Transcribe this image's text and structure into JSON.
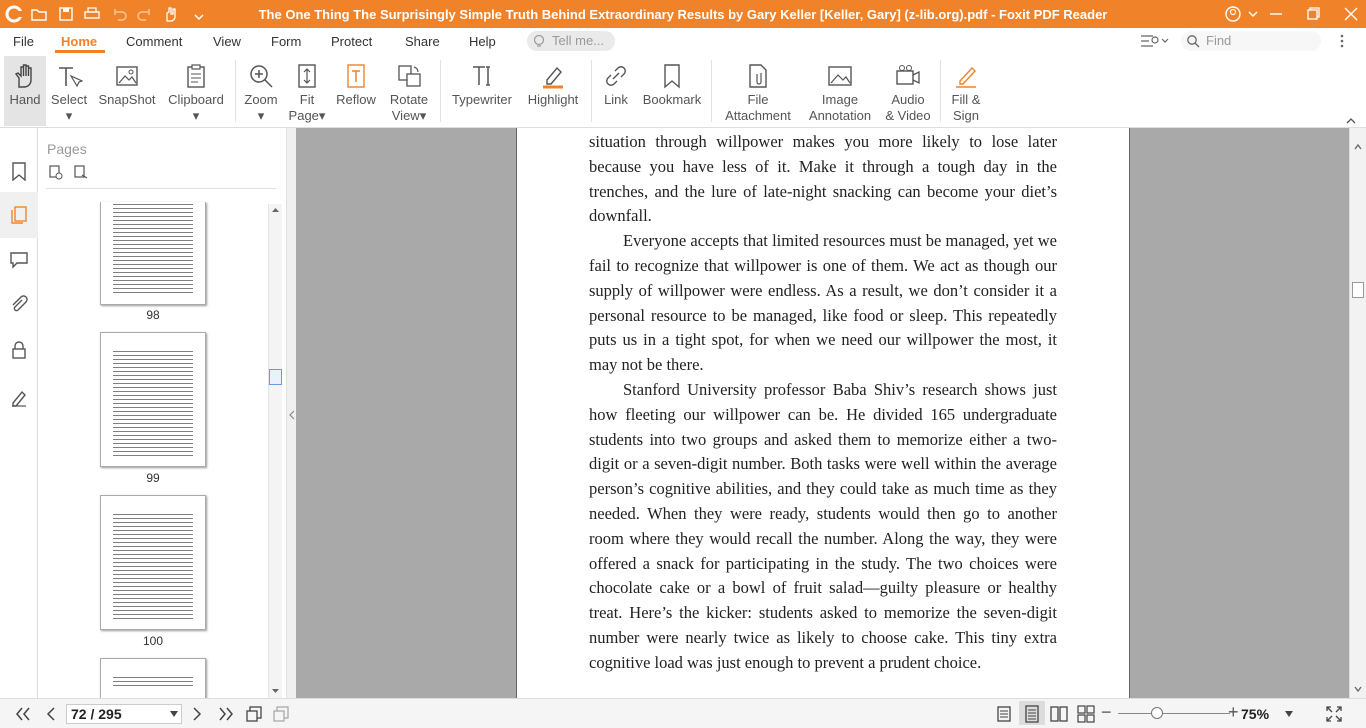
{
  "app": {
    "window_title": "The One Thing The Surprisingly Simple Truth Behind Extraordinary Results by Gary Keller [Keller, Gary] (z-lib.org).pdf - Foxit PDF Reader",
    "accent_color": "#f0832a"
  },
  "menu": {
    "items": [
      "File",
      "Home",
      "Comment",
      "View",
      "Form",
      "Protect",
      "Share",
      "Help"
    ],
    "active": "Home",
    "tell_me_placeholder": "Tell me...",
    "find_placeholder": "Find"
  },
  "ribbon": {
    "tools": [
      {
        "line1": "Hand",
        "line2": "",
        "icon": "hand-icon"
      },
      {
        "line1": "Select",
        "line2": "",
        "icon": "select-text-icon"
      },
      {
        "line1": "SnapShot",
        "line2": "",
        "icon": "snapshot-icon"
      },
      {
        "line1": "Clipboard",
        "line2": "",
        "icon": "clipboard-icon"
      },
      {
        "line1": "Zoom",
        "line2": "",
        "icon": "zoom-icon"
      },
      {
        "line1": "Fit",
        "line2": "Page",
        "icon": "fit-page-icon"
      },
      {
        "line1": "Reflow",
        "line2": "",
        "icon": "reflow-icon"
      },
      {
        "line1": "Rotate",
        "line2": "View",
        "icon": "rotate-view-icon"
      },
      {
        "line1": "Typewriter",
        "line2": "",
        "icon": "typewriter-icon"
      },
      {
        "line1": "Highlight",
        "line2": "",
        "icon": "highlight-icon"
      },
      {
        "line1": "Link",
        "line2": "",
        "icon": "link-icon"
      },
      {
        "line1": "Bookmark",
        "line2": "",
        "icon": "bookmark-icon"
      },
      {
        "line1": "File",
        "line2": "Attachment",
        "icon": "file-attachment-icon"
      },
      {
        "line1": "Image",
        "line2": "Annotation",
        "icon": "image-annotation-icon"
      },
      {
        "line1": "Audio",
        "line2": "& Video",
        "icon": "audio-video-icon"
      },
      {
        "line1": "Fill &",
        "line2": "Sign",
        "icon": "fill-sign-icon"
      }
    ]
  },
  "pages_panel": {
    "title": "Pages",
    "thumbnails": [
      {
        "label": "98"
      },
      {
        "label": "99"
      },
      {
        "label": "100"
      }
    ]
  },
  "document": {
    "paragraphs": [
      {
        "indent": false,
        "text": "situation through willpower makes you more likely to lose later because you have less of it. Make it through a tough day in the trenches, and the lure of late-night snacking can become your diet’s downfall."
      },
      {
        "indent": true,
        "text": "Everyone accepts that limited resources must be managed, yet we fail to recognize that willpower is one of them. We act as though our supply of willpower were endless. As a result, we don’t consider it a personal resource to be managed, like food or sleep. This repeatedly puts us in a tight spot, for when we need our willpower the most, it may not be there."
      },
      {
        "indent": true,
        "text": "Stanford University professor Baba Shiv’s research shows just how fleeting our willpower can be. He divided 165 undergraduate students into two groups and asked them to memorize either a two-digit or a seven-digit number. Both tasks were well within the average person’s cognitive abilities, and they could take as much time as they needed. When they were ready, students would then go to another room where they would recall the number. Along the way, they were offered a snack for participating in the study. The two choices were chocolate cake or a bowl of fruit salad—guilty pleasure or healthy treat. Here’s the kicker: students asked to memorize the seven-digit number were nearly twice as likely to choose cake. This tiny extra cognitive load was just enough to prevent a prudent choice."
      }
    ]
  },
  "status": {
    "page_indicator": "72 / 295",
    "zoom": "75%"
  }
}
